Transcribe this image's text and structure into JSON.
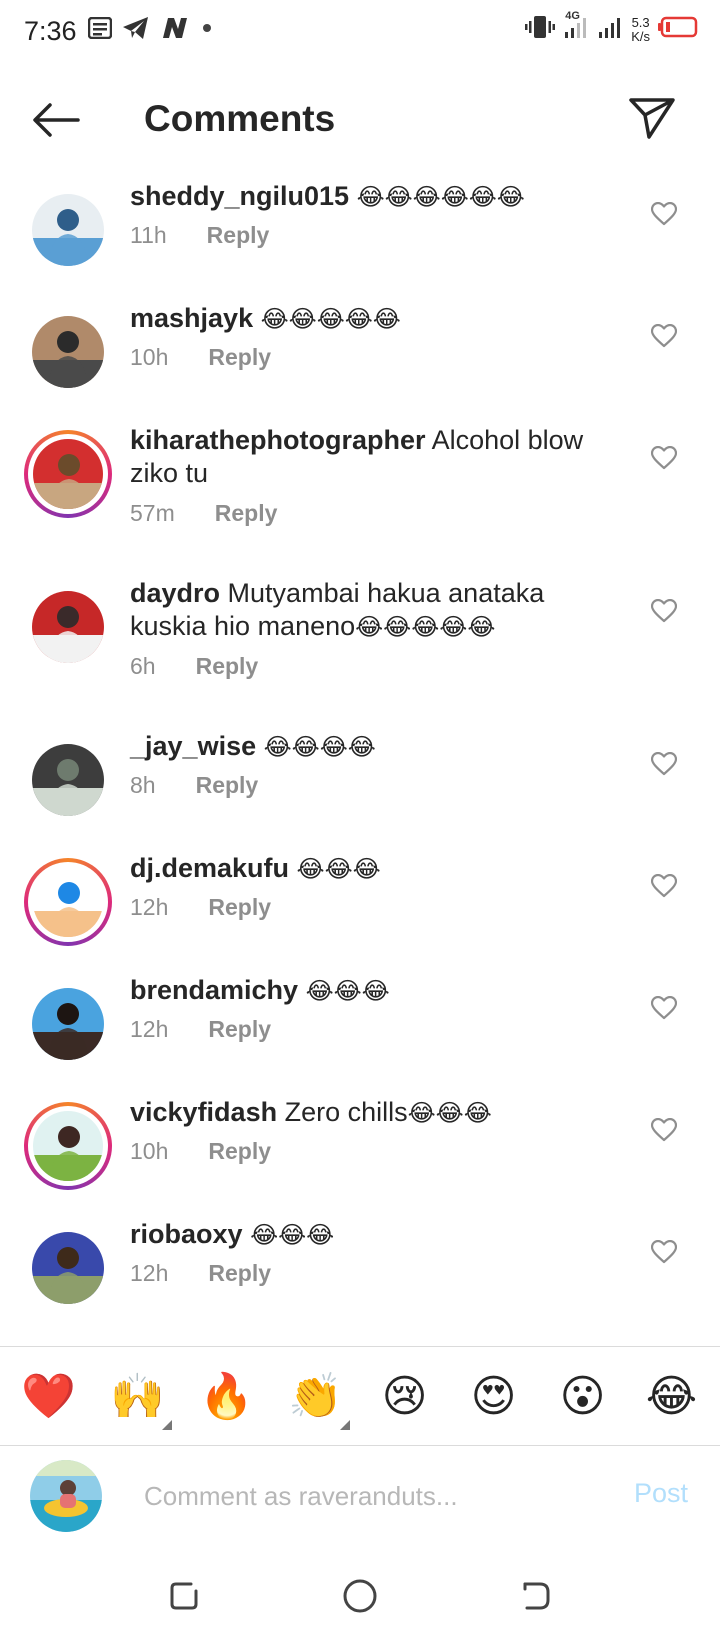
{
  "status_bar": {
    "time": "7:36",
    "network_type": "4G",
    "speed_value": "5.3",
    "speed_unit": "K/s",
    "icons": [
      "notes-icon",
      "telegram-icon",
      "n-app-icon",
      "dot-icon",
      "vibrate-icon",
      "signal-icon",
      "signal-icon",
      "battery-low-icon"
    ],
    "battery_color": "#e53935"
  },
  "header": {
    "title": "Comments",
    "back_icon": "arrow-left-icon",
    "share_icon": "paper-plane-icon"
  },
  "comments": [
    {
      "username": "sheddy_ngilu015",
      "text": "",
      "emoji": "😂😂😂😂😂😂",
      "time": "11h",
      "reply": "Reply",
      "story": false,
      "avatar_colors": [
        "#5a9fd4",
        "#e8eef2",
        "#2f5e8a"
      ]
    },
    {
      "username": "mashjayk",
      "text": "",
      "emoji": "😂😂😂😂😂",
      "time": "10h",
      "reply": "Reply",
      "story": false,
      "avatar_colors": [
        "#4a4a4a",
        "#b08a6a",
        "#2b2b2b"
      ]
    },
    {
      "username": "kiharathephotographer",
      "text": "Alcohol blow ziko tu",
      "emoji": "",
      "time": "57m",
      "reply": "Reply",
      "story": true,
      "avatar_colors": [
        "#c8a680",
        "#d32f2f",
        "#6b4b2b"
      ]
    },
    {
      "username": "daydro",
      "text": "Mutyambai hakua anataka kuskia hio maneno",
      "emoji": "😂😂😂😂😂",
      "time": "6h",
      "reply": "Reply",
      "story": false,
      "avatar_colors": [
        "#f2f2f2",
        "#c62828",
        "#3a2a2a"
      ]
    },
    {
      "username": "_jay_wise",
      "text": "",
      "emoji": "😂😂😂😂",
      "time": "8h",
      "reply": "Reply",
      "story": false,
      "avatar_colors": [
        "#cfd8cf",
        "#3d3d3d",
        "#6e7b6e"
      ]
    },
    {
      "username": "dj.demakufu",
      "text": "",
      "emoji": "😂😂😂",
      "time": "12h",
      "reply": "Reply",
      "story": true,
      "avatar_colors": [
        "#f5c18a",
        "#ffffff",
        "#1e88e5"
      ]
    },
    {
      "username": "brendamichy",
      "text": "",
      "emoji": "😂😂😂",
      "time": "12h",
      "reply": "Reply",
      "story": false,
      "avatar_colors": [
        "#3b2a25",
        "#4aa3df",
        "#1d1512"
      ]
    },
    {
      "username": "vickyfidash",
      "text": "Zero chills",
      "emoji": "😂😂😂",
      "time": "10h",
      "reply": "Reply",
      "story": true,
      "avatar_colors": [
        "#7cb342",
        "#e0f2f1",
        "#3e2723"
      ]
    },
    {
      "username": "riobaoxy",
      "text": "",
      "emoji": "😂😂😂",
      "time": "12h",
      "reply": "Reply",
      "story": false,
      "avatar_colors": [
        "#8d9e6b",
        "#3949ab",
        "#3e2a1a"
      ]
    }
  ],
  "reactions": [
    {
      "emoji": "❤️",
      "name": "heart-emoji",
      "has_variants": false
    },
    {
      "emoji": "🙌",
      "name": "raised-hands-emoji",
      "has_variants": true
    },
    {
      "emoji": "🔥",
      "name": "fire-emoji",
      "has_variants": false
    },
    {
      "emoji": "👏",
      "name": "clapping-emoji",
      "has_variants": true
    },
    {
      "emoji": "😢",
      "name": "crying-emoji",
      "has_variants": false
    },
    {
      "emoji": "😍",
      "name": "heart-eyes-emoji",
      "has_variants": false
    },
    {
      "emoji": "😮",
      "name": "surprised-emoji",
      "has_variants": false
    },
    {
      "emoji": "😂",
      "name": "tears-of-joy-emoji",
      "has_variants": false
    }
  ],
  "composer": {
    "placeholder": "Comment as raveranduts...",
    "value": "",
    "post_label": "Post",
    "post_color": "#b2dffc"
  },
  "nav_bar": {
    "icons": [
      "recents-icon",
      "home-icon",
      "back-icon"
    ]
  }
}
